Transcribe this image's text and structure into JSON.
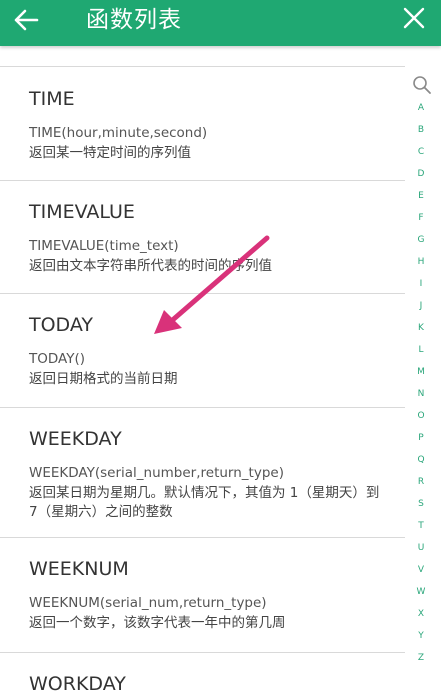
{
  "header": {
    "title": "函数列表"
  },
  "functions": [
    {
      "name": "TIME",
      "syntax": "TIME(hour,minute,second)",
      "desc": "返回某一特定时间的序列值"
    },
    {
      "name": "TIMEVALUE",
      "syntax": "TIMEVALUE(time_text)",
      "desc": "返回由文本字符串所代表的时间的序列值"
    },
    {
      "name": "TODAY",
      "syntax": "TODAY()",
      "desc": "返回日期格式的当前日期"
    },
    {
      "name": "WEEKDAY",
      "syntax": "WEEKDAY(serial_number,return_type)",
      "desc": "返回某日期为星期几。默认情况下，其值为 1（星期天）到 7（星期六）之间的整数"
    },
    {
      "name": "WEEKNUM",
      "syntax": "WEEKNUM(serial_num,return_type)",
      "desc": "返回一个数字，该数字代表一年中的第几周"
    },
    {
      "name": "WORKDAY",
      "syntax": "",
      "desc": ""
    }
  ],
  "index_letters": [
    "A",
    "B",
    "C",
    "D",
    "E",
    "F",
    "G",
    "H",
    "I",
    "J",
    "K",
    "L",
    "M",
    "N",
    "O",
    "P",
    "Q",
    "R",
    "S",
    "T",
    "U",
    "V",
    "W",
    "X",
    "Y",
    "Z"
  ],
  "colors": {
    "header_bg": "#1fa872",
    "index_letter": "#2aa67a",
    "annotation_arrow": "#d9327a"
  },
  "icons": {
    "back": "arrow-left-icon",
    "close": "close-icon",
    "search": "search-icon"
  }
}
